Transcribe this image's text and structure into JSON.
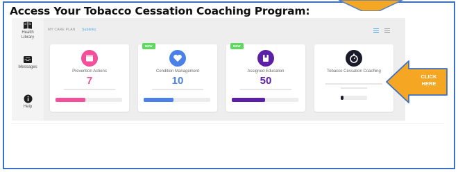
{
  "heading": "Access Your Tobacco Cessation Coaching Program:",
  "colors": {
    "frame": "#3b6fc4",
    "orange": "#f5a623",
    "pink": "#f2509a",
    "blue": "#4a80e8",
    "purple": "#5b1fa8",
    "dark": "#1a1a2a",
    "green": "#5fd85f"
  },
  "sidebar": {
    "items": [
      {
        "label1": "Health",
        "label2": "Library",
        "icon": "book-icon"
      },
      {
        "label1": "Messages",
        "label2": "",
        "icon": "inbox-icon"
      },
      {
        "label1": "Help",
        "label2": "",
        "icon": "info-icon"
      }
    ]
  },
  "breadcrumb": {
    "main": "MY CARE PLAN",
    "sub": "Sublinks"
  },
  "cards": [
    {
      "title": "Prevention Actions",
      "value": "7",
      "badge": "",
      "icon": "calendar-icon",
      "progress": 0.45
    },
    {
      "title": "Condition Management",
      "value": "10",
      "badge": "NEW",
      "icon": "heart-icon",
      "progress": 0.45
    },
    {
      "title": "Assigned Education",
      "value": "50",
      "badge": "NEW",
      "icon": "book-icon",
      "progress": 0.5
    },
    {
      "title": "Tobacco Cessation Coaching",
      "value": "",
      "badge": "",
      "icon": "stopwatch-icon",
      "progress": 0.1
    }
  ],
  "callout": {
    "line1": "CLICK",
    "line2": "HERE"
  }
}
